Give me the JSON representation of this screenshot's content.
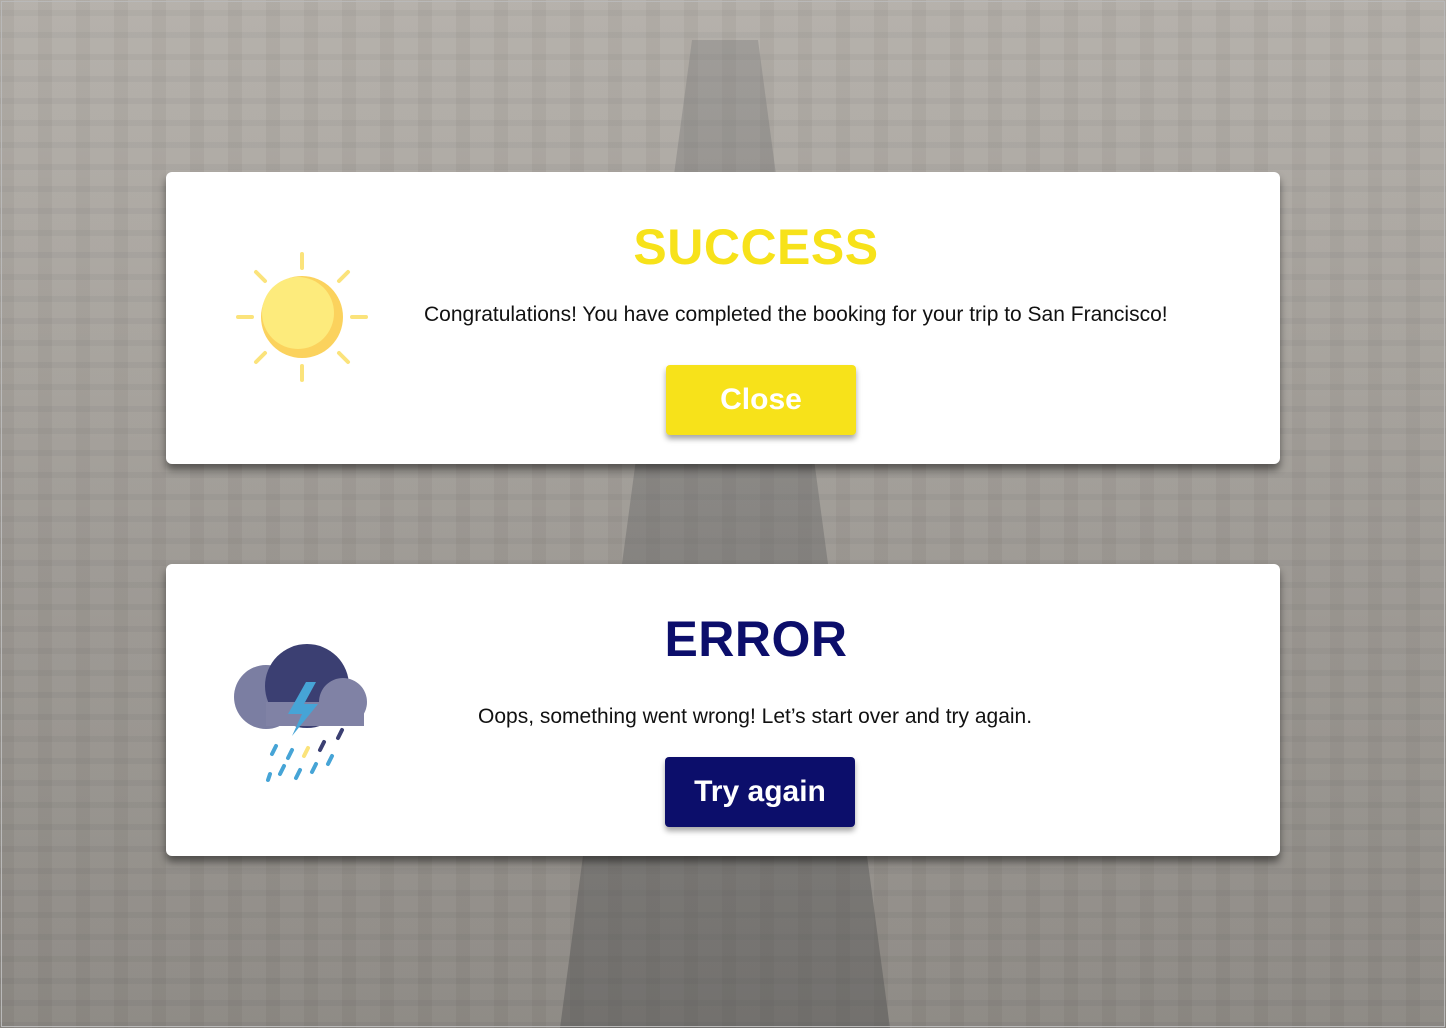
{
  "success_dialog": {
    "title": "SUCCESS",
    "message": "Congratulations! You have completed the booking for your trip to San Francisco!",
    "button_label": "Close",
    "icon": "sun-icon",
    "accent_color": "#f7e21a"
  },
  "error_dialog": {
    "title": "ERROR",
    "message": "Oops, something went wrong! Let’s start over and try again.",
    "button_label": "Try again",
    "icon": "storm-cloud-icon",
    "accent_color": "#0c0e6b"
  }
}
